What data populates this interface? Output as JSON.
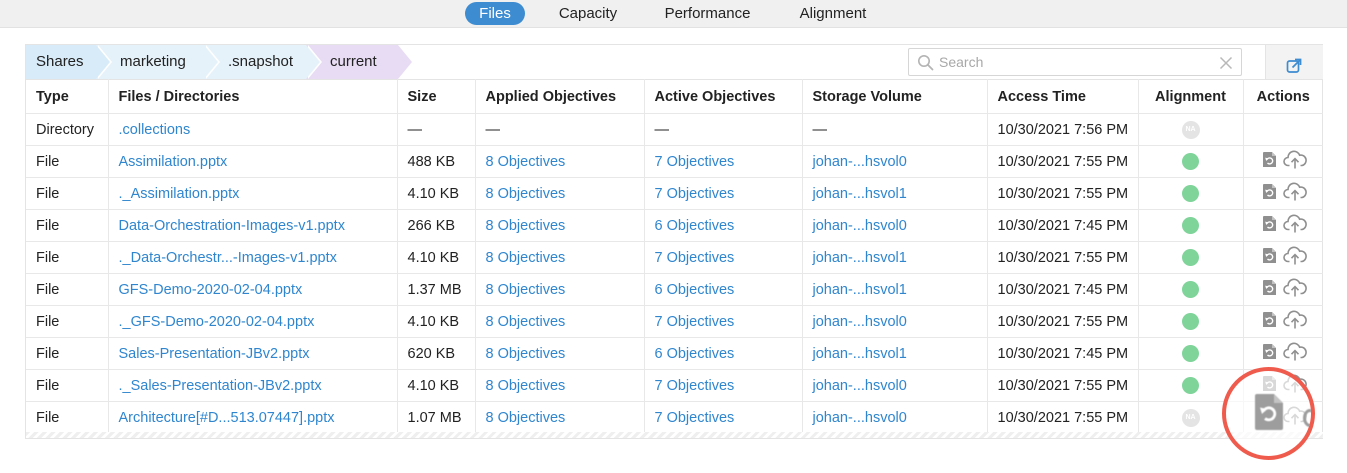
{
  "tabs": [
    {
      "label": "Files",
      "active": true
    },
    {
      "label": "Capacity",
      "active": false
    },
    {
      "label": "Performance",
      "active": false
    },
    {
      "label": "Alignment",
      "active": false
    }
  ],
  "breadcrumb": [
    {
      "label": "Shares",
      "color": "#d8ebf8"
    },
    {
      "label": "marketing",
      "color": "#e6f2fa"
    },
    {
      "label": ".snapshot",
      "color": "#e6f2fa"
    },
    {
      "label": "current",
      "color": "#e8dcf4"
    }
  ],
  "search": {
    "placeholder": "Search",
    "value": ""
  },
  "icons": {
    "search": "search-icon",
    "clear": "close-icon",
    "export": "external-link-icon",
    "restore": "restore-file-icon",
    "upload": "cloud-upload-icon"
  },
  "table": {
    "headers": [
      "Type",
      "Files / Directories",
      "Size",
      "Applied Objectives",
      "Active Objectives",
      "Storage Volume",
      "Access Time",
      "Alignment",
      "Actions"
    ],
    "rows": [
      {
        "type": "Directory",
        "name": ".collections",
        "size": "—",
        "applied": "—",
        "active": "—",
        "volume": "—",
        "time": "10/30/2021 7:56 PM",
        "alignment": "na",
        "na_label": "NA",
        "actions": false
      },
      {
        "type": "File",
        "name": "Assimilation.pptx",
        "size": "488 KB",
        "applied": "8 Objectives",
        "active": "7 Objectives",
        "volume": "johan-...hsvol0",
        "time": "10/30/2021 7:55 PM",
        "alignment": "ok",
        "actions": true
      },
      {
        "type": "File",
        "name": "._Assimilation.pptx",
        "size": "4.10 KB",
        "applied": "8 Objectives",
        "active": "7 Objectives",
        "volume": "johan-...hsvol1",
        "time": "10/30/2021 7:55 PM",
        "alignment": "ok",
        "actions": true
      },
      {
        "type": "File",
        "name": "Data-Orchestration-Images-v1.pptx",
        "size": "266 KB",
        "applied": "8 Objectives",
        "active": "6 Objectives",
        "volume": "johan-...hsvol0",
        "time": "10/30/2021 7:45 PM",
        "alignment": "ok",
        "actions": true
      },
      {
        "type": "File",
        "name": "._Data-Orchestr...-Images-v1.pptx",
        "size": "4.10 KB",
        "applied": "8 Objectives",
        "active": "7 Objectives",
        "volume": "johan-...hsvol1",
        "time": "10/30/2021 7:55 PM",
        "alignment": "ok",
        "actions": true
      },
      {
        "type": "File",
        "name": "GFS-Demo-2020-02-04.pptx",
        "size": "1.37 MB",
        "applied": "8 Objectives",
        "active": "6 Objectives",
        "volume": "johan-...hsvol1",
        "time": "10/30/2021 7:45 PM",
        "alignment": "ok",
        "actions": true
      },
      {
        "type": "File",
        "name": "._GFS-Demo-2020-02-04.pptx",
        "size": "4.10 KB",
        "applied": "8 Objectives",
        "active": "7 Objectives",
        "volume": "johan-...hsvol0",
        "time": "10/30/2021 7:55 PM",
        "alignment": "ok",
        "actions": true
      },
      {
        "type": "File",
        "name": "Sales-Presentation-JBv2.pptx",
        "size": "620 KB",
        "applied": "8 Objectives",
        "active": "6 Objectives",
        "volume": "johan-...hsvol1",
        "time": "10/30/2021 7:45 PM",
        "alignment": "ok",
        "actions": true
      },
      {
        "type": "File",
        "name": "._Sales-Presentation-JBv2.pptx",
        "size": "4.10 KB",
        "applied": "8 Objectives",
        "active": "7 Objectives",
        "volume": "johan-...hsvol0",
        "time": "10/30/2021 7:55 PM",
        "alignment": "ok",
        "actions": true
      },
      {
        "type": "File",
        "name": "Architecture[#D...513.07447].pptx",
        "size": "1.07 MB",
        "applied": "8 Objectives",
        "active": "7 Objectives",
        "volume": "johan-...hsvol0",
        "time": "10/30/2021 7:55 PM",
        "alignment": "na",
        "na_label": "NA",
        "actions": true
      }
    ]
  },
  "colors": {
    "accent": "#3d8bd0",
    "link": "#2f86cf",
    "aligned": "#7fd49a",
    "highlight_ring": "#ef5b4c",
    "icon_gray": "#8f8f8f"
  }
}
